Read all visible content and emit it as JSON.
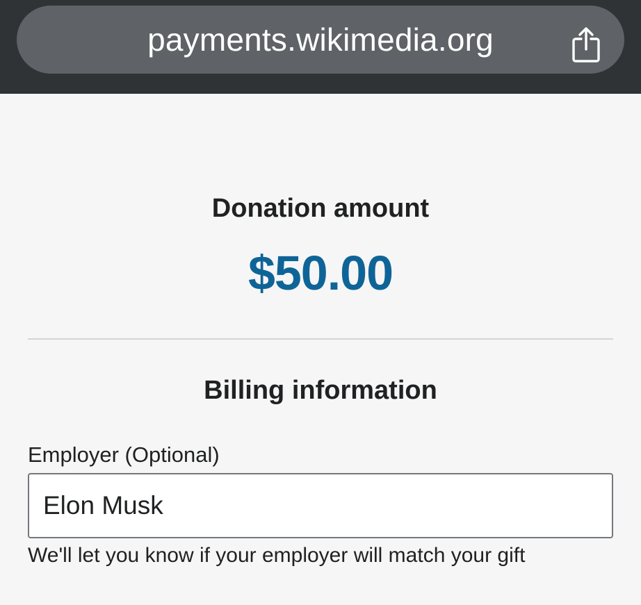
{
  "browser": {
    "url": "payments.wikimedia.org",
    "share_icon": "share-icon"
  },
  "donation": {
    "label": "Donation amount",
    "amount": "$50.00",
    "amount_color": "#0f6497"
  },
  "billing": {
    "heading": "Billing information",
    "employer": {
      "label": "Employer (Optional)",
      "value": "Elon Musk",
      "helper": "We'll let you know if your employer will match your gift"
    }
  }
}
